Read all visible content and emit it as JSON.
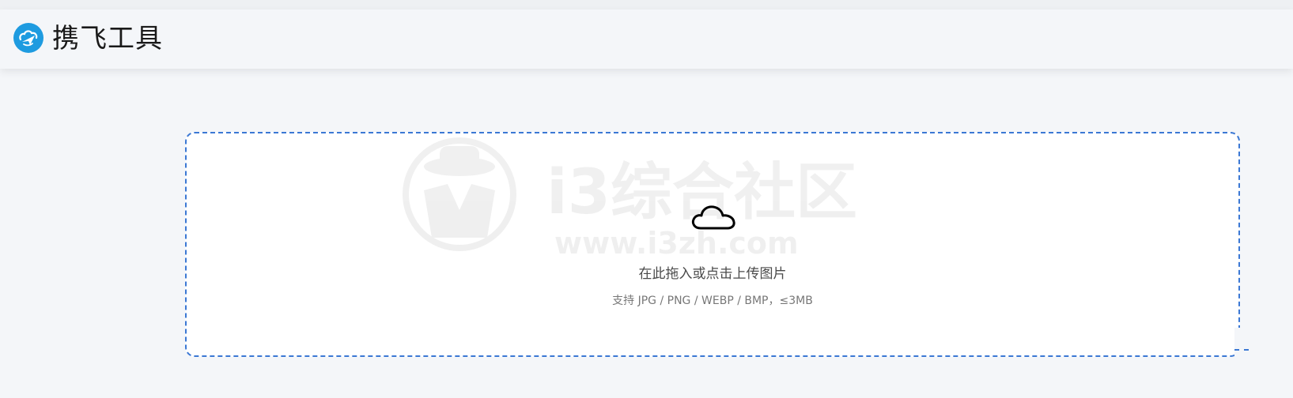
{
  "brand": {
    "name": "携飞工具",
    "logo_icon": "cloud-paper-plane-icon",
    "logo_color": "#1e9be0"
  },
  "dropzone": {
    "icon": "cloud-upload-icon",
    "title": "在此拖入或点击上传图片",
    "subtitle": "支持 JPG / PNG / WEBP / BMP，≤3MB",
    "border_color": "#3b78d4"
  },
  "watermark": {
    "text": "i3综合社区",
    "url": "www.i3zh.com"
  }
}
